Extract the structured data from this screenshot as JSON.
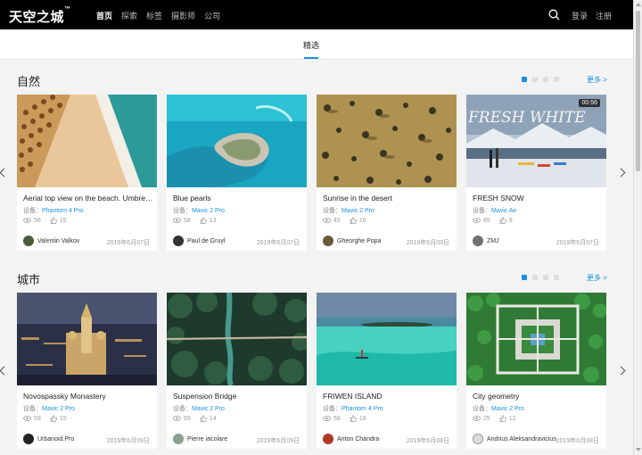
{
  "header": {
    "logo": "天空之城",
    "logo_mark": "™",
    "nav": [
      "首页",
      "探索",
      "标签",
      "摄影师",
      "公司"
    ],
    "login": "登录",
    "register": "注册"
  },
  "subnav": {
    "tab": "精选"
  },
  "device_prefix": "设备：",
  "sections": [
    {
      "title": "自然",
      "more": "更多 >",
      "cards": [
        {
          "title": "Aerial top view on the beach. Umbrellas",
          "device": "Phantom 4 Pro",
          "views": "56",
          "likes": "15",
          "author": "Valentin Valkov",
          "date": "2019年6月07日"
        },
        {
          "title": "Blue pearls",
          "device": "Mavic 2 Pro",
          "views": "58",
          "likes": "13",
          "author": "Paul de Gruyl",
          "date": "2019年6月07日"
        },
        {
          "title": "Sunrise in the desert",
          "device": "Mavic 2 Pro",
          "views": "45",
          "likes": "16",
          "author": "Gheorghe Popa",
          "date": "2019年6月09日"
        },
        {
          "title": "FRESH SNOW",
          "device": "Mavic Air",
          "views": "85",
          "likes": "9",
          "author": "ZMJ",
          "date": "2019年6月07日",
          "badge": "00:56",
          "overlay": "FRESH WHITE"
        }
      ]
    },
    {
      "title": "城市",
      "more": "更多 >",
      "cards": [
        {
          "title": "Novospassky Monastery",
          "device": "Mavic 2 Pro",
          "views": "59",
          "likes": "15",
          "author": "Urbanoid.Pro",
          "date": "2019年6月09日"
        },
        {
          "title": "Suspension Bridge",
          "device": "Mavic 2 Pro",
          "views": "69",
          "likes": "14",
          "author": "Pierre iacolare",
          "date": "2019年6月09日"
        },
        {
          "title": "FRIWEN ISLAND",
          "device": "Phantom 4 Pro",
          "views": "58",
          "likes": "16",
          "author": "Anton Chandra",
          "date": "2019年6月08日"
        },
        {
          "title": "City geometry",
          "device": "Mavic 2 Pro",
          "views": "25",
          "likes": "12",
          "author": "Andrius Aleksandravicius",
          "date": "2019年6月08日"
        }
      ]
    }
  ],
  "colors": {
    "accent": "#1a8fe3",
    "topbar": "#000000"
  }
}
